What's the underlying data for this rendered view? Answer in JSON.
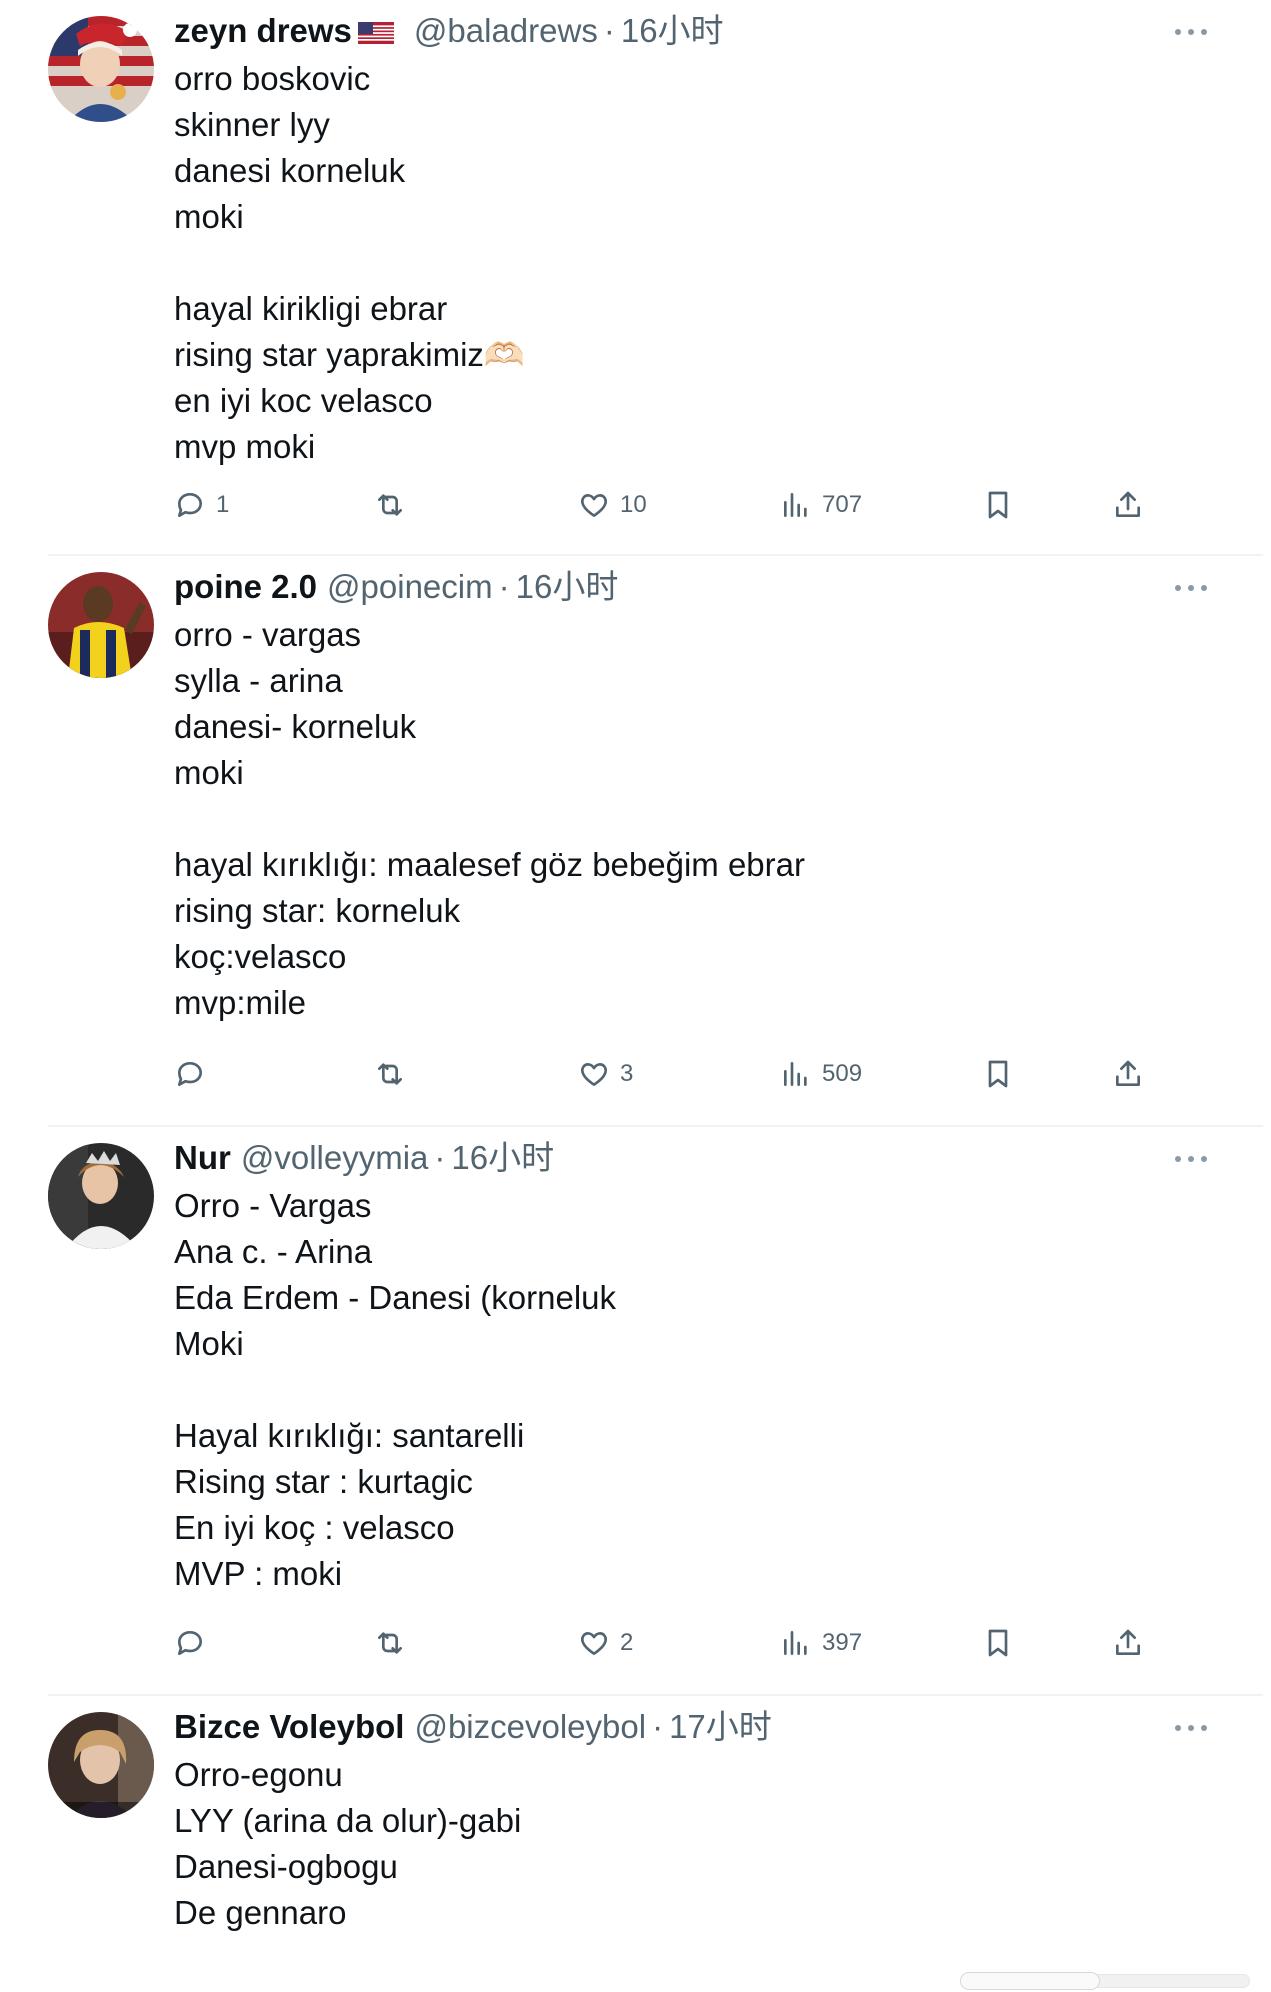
{
  "tweets": [
    {
      "name": "zeyn drews",
      "flag": "us-flag",
      "handle": "@baladrews",
      "separator": "·",
      "time": "16小时",
      "body": "orro boskovic\nskinner lyy\ndanesi korneluk\nmoki\n\nhayal kirikligi ebrar\nrising star yaprakimiz🫶🏻\nen iyi koc velasco\nmvp moki",
      "replies": "1",
      "retweets": "",
      "likes": "10",
      "views": "707"
    },
    {
      "name": "poine 2.0",
      "handle": "@poinecim",
      "separator": "·",
      "time": "16小时",
      "body": "orro - vargas\nsylla - arina\ndanesi- korneluk\nmoki\n\nhayal kırıklığı: maalesef göz bebeğim ebrar\nrising star: korneluk\nkoç:velasco\nmvp:mile",
      "replies": "",
      "retweets": "",
      "likes": "3",
      "views": "509"
    },
    {
      "name": "Nur",
      "handle": "@volleyymia",
      "separator": "·",
      "time": "16小时",
      "body": "Orro - Vargas\nAna c. - Arina\nEda Erdem - Danesi (korneluk\nMoki\n\nHayal kırıklığı: santarelli\nRising star : kurtagic\nEn iyi koç : velasco\nMVP : moki",
      "replies": "",
      "retweets": "",
      "likes": "2",
      "views": "397"
    },
    {
      "name": "Bizce Voleybol",
      "handle": "@bizcevoleybol",
      "separator": "·",
      "time": "17小时",
      "body": "Orro-egonu\nLYY (arina da olur)-gabi\nDanesi-ogbogu\nDe gennaro"
    }
  ],
  "icons": {
    "reply": "reply-icon",
    "retweet": "retweet-icon",
    "like": "heart-icon",
    "views": "views-icon",
    "bookmark": "bookmark-icon",
    "share": "share-icon",
    "more": "more-icon"
  },
  "colors": {
    "text": "#0f1419",
    "secondary": "#536471",
    "divider": "#eff3f4"
  }
}
